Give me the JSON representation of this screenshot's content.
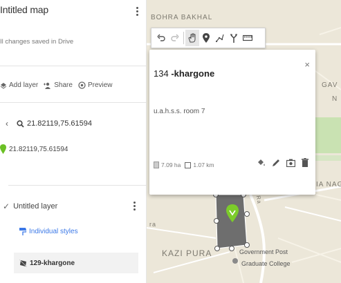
{
  "sidebar": {
    "map_title": "Intitled map",
    "save_status": "Il changes saved in Drive",
    "actions": {
      "add_layer": "Add layer",
      "share": "Share",
      "preview": "Preview"
    },
    "search": {
      "back_icon": "arrow-left-icon",
      "query": "21.82119,75.61594"
    },
    "search_result": {
      "label": "21.82119,75.61594",
      "pin_color": "#6bc025"
    },
    "layer": {
      "name": "Untitled layer",
      "style_link": "Individual styles",
      "feature_name": "129-khargone"
    }
  },
  "map": {
    "labels": {
      "top": "BOHRA BAKHAL",
      "right_gav": "GAV",
      "right_n": "N",
      "right_nag": "IA NAG",
      "bottom_left": "KAZI PURA",
      "poi_line1": "Government Post",
      "poi_line2": "Graduate College",
      "left_edge": "ra",
      "road": "Ra"
    },
    "toolbar": {
      "tools": [
        "undo-icon",
        "redo-icon",
        "hand-icon",
        "marker-icon",
        "draw-line-icon",
        "directions-icon",
        "ruler-icon"
      ]
    },
    "popup": {
      "id": "134",
      "name": "-khargone",
      "description": "u.a.h.s.s. room 7",
      "area": "7.09 ha",
      "perimeter": "1.07 km",
      "close_label": "×"
    },
    "colors": {
      "map_bg": "#ece7d9",
      "polygon_fill": "#6e6e6e",
      "pin": "#7ccc2a",
      "accent_blue": "#3b78e7"
    }
  }
}
